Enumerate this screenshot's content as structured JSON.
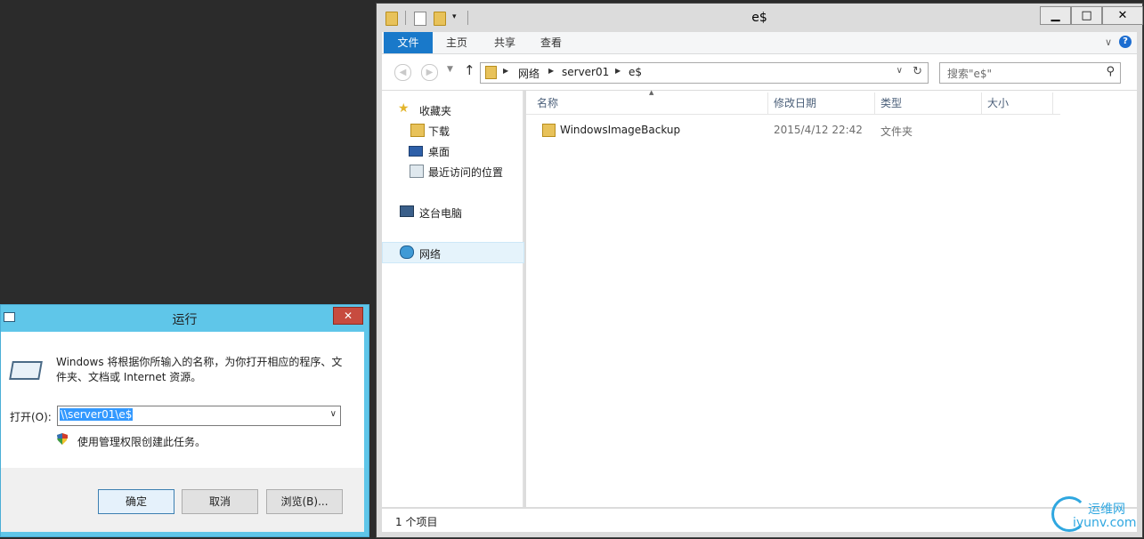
{
  "explorer": {
    "title": "e$",
    "window_buttons": {
      "minimize": "▁",
      "maximize": "□",
      "close": "✕"
    },
    "ribbon_tabs": [
      "文件",
      "主页",
      "共享",
      "查看"
    ],
    "help": "?",
    "address": {
      "crumbs": [
        "网络",
        "server01",
        "e$"
      ]
    },
    "search_placeholder": "搜索\"e$\"",
    "nav_pane": {
      "favorites": "收藏夹",
      "downloads": "下载",
      "desktop": "桌面",
      "recent": "最近访问的位置",
      "this_pc": "这台电脑",
      "network": "网络"
    },
    "columns": [
      "名称",
      "修改日期",
      "类型",
      "大小"
    ],
    "rows": [
      {
        "name": "WindowsImageBackup",
        "date": "2015/4/12 22:42",
        "type": "文件夹",
        "size": ""
      }
    ],
    "status": "1 个项目"
  },
  "run_dialog": {
    "title": "运行",
    "close": "✕",
    "description": "Windows 将根据你所输入的名称，为你打开相应的程序、文件夹、文档或 Internet 资源。",
    "open_label": "打开(O):",
    "input_value": "\\\\server01\\e$",
    "admin_note": "使用管理权限创建此任务。",
    "buttons": {
      "ok": "确定",
      "cancel": "取消",
      "browse": "浏览(B)..."
    }
  },
  "watermark": {
    "line1": "运维网",
    "line2": "iyunv.com"
  },
  "colors": {
    "accent": "#1979ca",
    "run_title": "#5fc6e9",
    "close": "#c74b3f"
  }
}
